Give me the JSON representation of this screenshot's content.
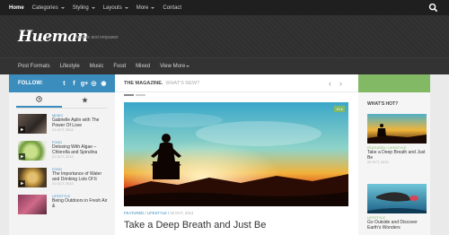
{
  "topnav": {
    "items": [
      {
        "label": "Home",
        "caret": false
      },
      {
        "label": "Categories",
        "caret": true
      },
      {
        "label": "Styling",
        "caret": true
      },
      {
        "label": "Layouts",
        "caret": true
      },
      {
        "label": "More",
        "caret": true
      },
      {
        "label": "Contact",
        "caret": false
      }
    ]
  },
  "header": {
    "logo": "Hueman",
    "tagline": "Inspire and empower"
  },
  "subnav": {
    "items": [
      "Post Formats",
      "Lifestyle",
      "Music",
      "Food",
      "Mixed",
      "View More"
    ]
  },
  "follow": {
    "label": "FOLLOW:",
    "icons": [
      "twitter-icon",
      "facebook-icon",
      "google-plus-icon",
      "dribbble-icon",
      "rss-icon"
    ],
    "glyphs": [
      "t",
      "f",
      "g+",
      "◎",
      "◉"
    ]
  },
  "sidebar_posts": [
    {
      "category": "MUSIC",
      "title": "Gabrielle Aplin with The Power Of Love",
      "date": "21 OCT, 2013"
    },
    {
      "category": "FOOD",
      "title": "Detoxing With Algae – Chlorella and Spirulina",
      "date": "21 OCT, 2013"
    },
    {
      "category": "FOOD",
      "title": "The Importance of Water and Drinking Lots Of It",
      "date": "21 OCT, 2013"
    },
    {
      "category": "LIFESTYLE",
      "title": "Being Outdoors in Fresh Air &",
      "date": ""
    }
  ],
  "magazine": {
    "title": "THE MAGAZINE.",
    "subtitle": "WHAT'S NEW?"
  },
  "featured": {
    "badge": "10 ▸",
    "category": "FEATURED / LIFESTYLE",
    "date": "20 OCT, 2013",
    "title": "Take a Deep Breath and Just Be"
  },
  "hot": {
    "label": "WHAT'S HOT?",
    "posts": [
      {
        "category": "FEATURED / LIFESTYLE",
        "title": "Take a Deep Breath and Just Be",
        "date": "20 OCT, 2013"
      },
      {
        "category": "LIFESTYLE",
        "title": "Go Outside and Discover Earth's Wonders",
        "date": ""
      }
    ]
  },
  "colors": {
    "accent_blue": "#3b8dbd",
    "accent_green": "#82b965",
    "dark_bar": "#1f1f1f"
  }
}
